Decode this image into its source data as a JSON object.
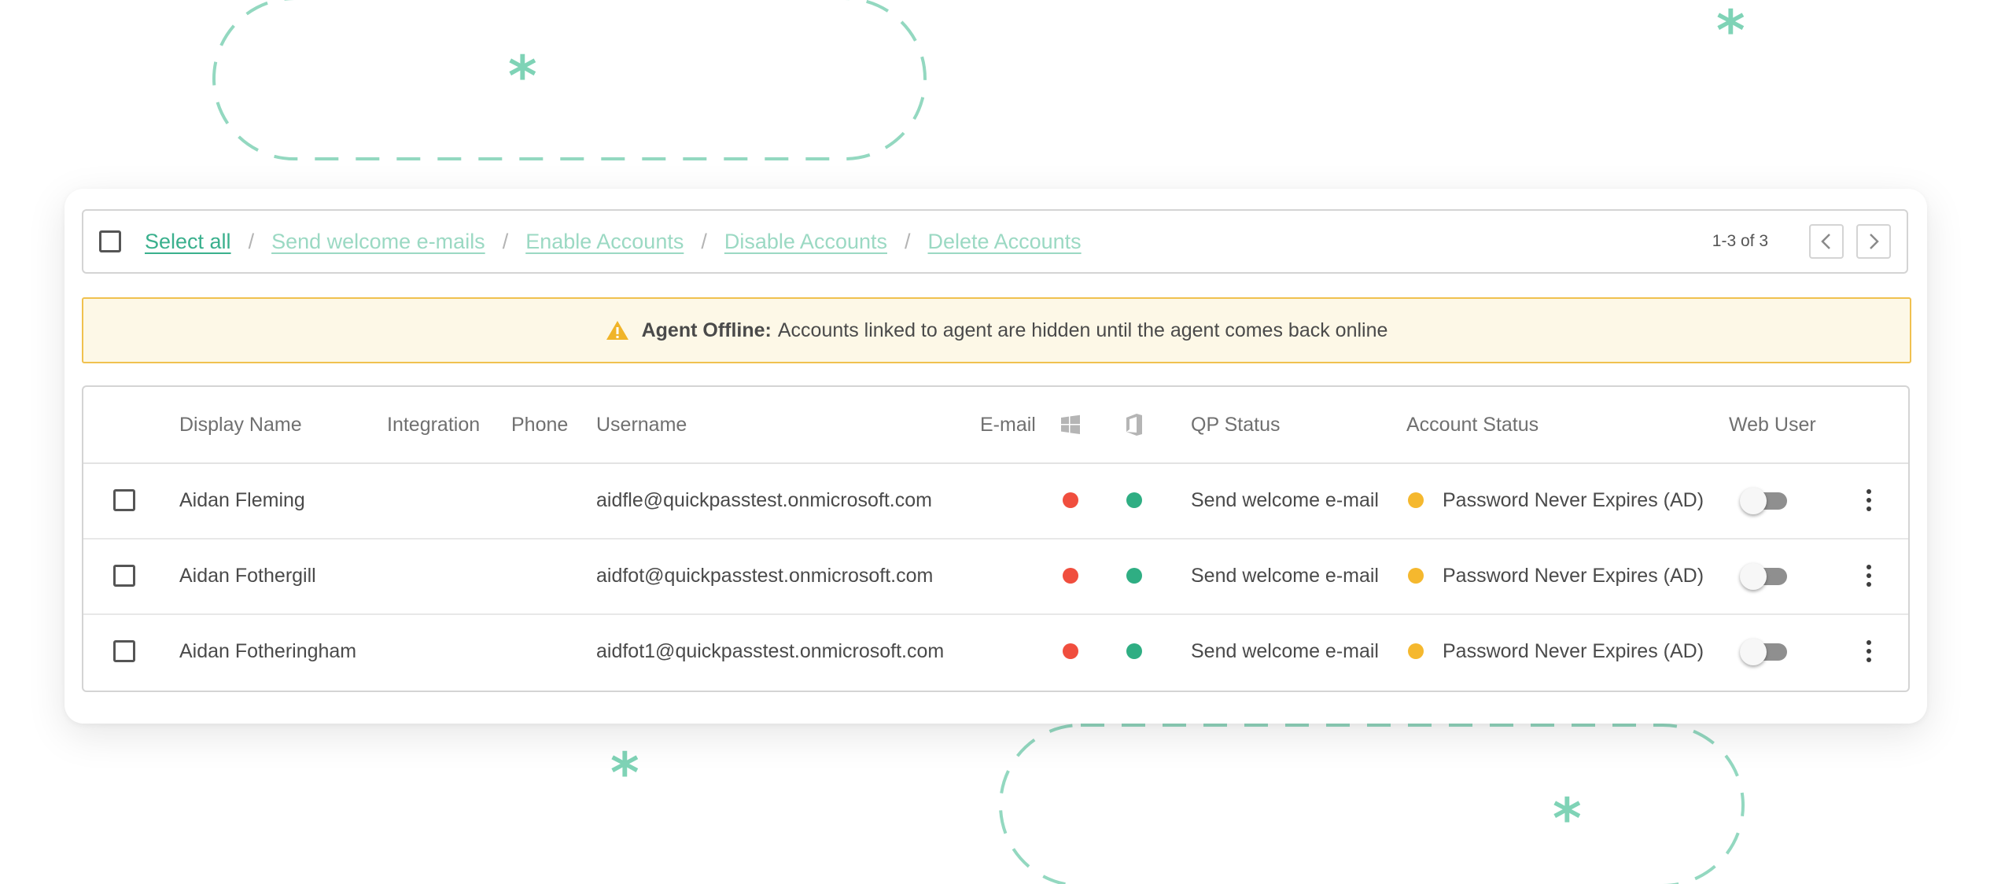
{
  "toolbar": {
    "select_all": "Select all",
    "separator": "/",
    "actions": [
      "Send welcome e-mails",
      "Enable Accounts",
      "Disable Accounts",
      "Delete Accounts"
    ],
    "pagination": "1-3 of 3"
  },
  "banner": {
    "title": "Agent Offline:",
    "message": "Accounts linked to agent are hidden until the agent comes back online",
    "icon": "warning-icon"
  },
  "table": {
    "headers": {
      "display_name": "Display Name",
      "integration": "Integration",
      "phone": "Phone",
      "username": "Username",
      "email": "E-mail",
      "windows_icon": "windows-icon",
      "office_icon": "office-icon",
      "qp_status": "QP Status",
      "account_status": "Account Status",
      "web_user": "Web User"
    },
    "rows": [
      {
        "display_name": "Aidan Fleming",
        "integration": "",
        "phone": "",
        "username": "aidfle@quickpasstest.onmicrosoft.com",
        "email": "",
        "windows_status": "red",
        "office_status": "green",
        "qp_status": "Send welcome e-mail",
        "account_status": "Password Never Expires (AD)",
        "account_status_color": "yellow",
        "web_user": false
      },
      {
        "display_name": "Aidan Fothergill",
        "integration": "",
        "phone": "",
        "username": "aidfot@quickpasstest.onmicrosoft.com",
        "email": "",
        "windows_status": "red",
        "office_status": "green",
        "qp_status": "Send welcome e-mail",
        "account_status": "Password Never Expires (AD)",
        "account_status_color": "yellow",
        "web_user": false
      },
      {
        "display_name": "Aidan Fotheringham",
        "integration": "",
        "phone": "",
        "username": "aidfot1@quickpasstest.onmicrosoft.com",
        "email": "",
        "windows_status": "red",
        "office_status": "green",
        "qp_status": "Send welcome e-mail",
        "account_status": "Password Never Expires (AD)",
        "account_status_color": "yellow",
        "web_user": false
      }
    ]
  },
  "colors": {
    "accent": "#3ab08d",
    "accent_light": "#9bd9c3",
    "decoration": "#7fd3b6",
    "red": "#f04e3e",
    "green": "#2fae83",
    "yellow": "#f5b82e",
    "warning_bg": "#fdf8e7",
    "warning_border": "#f0c14f"
  }
}
